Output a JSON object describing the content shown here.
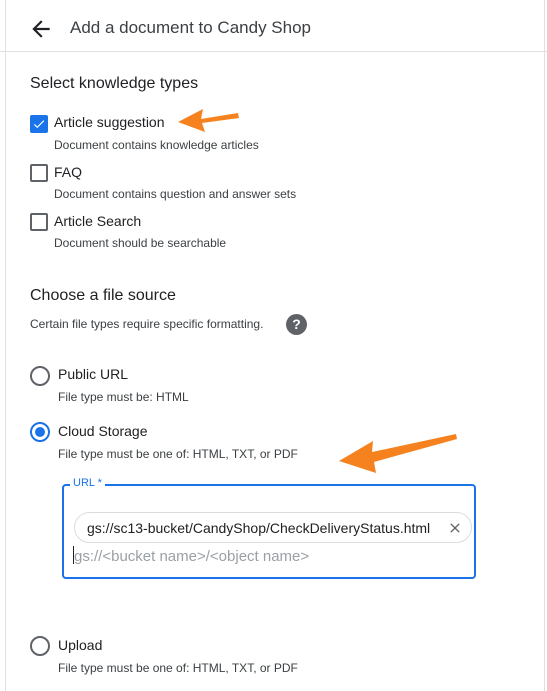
{
  "header": {
    "title": "Add a document to Candy Shop",
    "back_icon": "arrow-back-icon"
  },
  "knowledge_types": {
    "title": "Select knowledge types",
    "options": [
      {
        "label": "Article suggestion",
        "description": "Document contains knowledge articles",
        "checked": true
      },
      {
        "label": "FAQ",
        "description": "Document contains question and answer sets",
        "checked": false
      },
      {
        "label": "Article Search",
        "description": "Document should be searchable",
        "checked": false
      }
    ]
  },
  "file_source": {
    "title": "Choose a file source",
    "subtitle": "Certain file types require specific formatting.",
    "help_icon": "help-icon",
    "options": [
      {
        "label": "Public URL",
        "description": "File type must be: HTML",
        "selected": false
      },
      {
        "label": "Cloud Storage",
        "description": "File type must be one of: HTML, TXT, or PDF",
        "selected": true
      },
      {
        "label": "Upload",
        "description": "File type must be one of: HTML, TXT, or PDF",
        "selected": false
      }
    ],
    "url_field": {
      "label": "URL *",
      "chip_value": "gs://sc13-bucket/CandyShop/CheckDeliveryStatus.html",
      "placeholder": "gs://<bucket name>/<object name>"
    }
  },
  "colors": {
    "accent": "#1a73e8",
    "annotation_arrow": "#f5821f"
  }
}
